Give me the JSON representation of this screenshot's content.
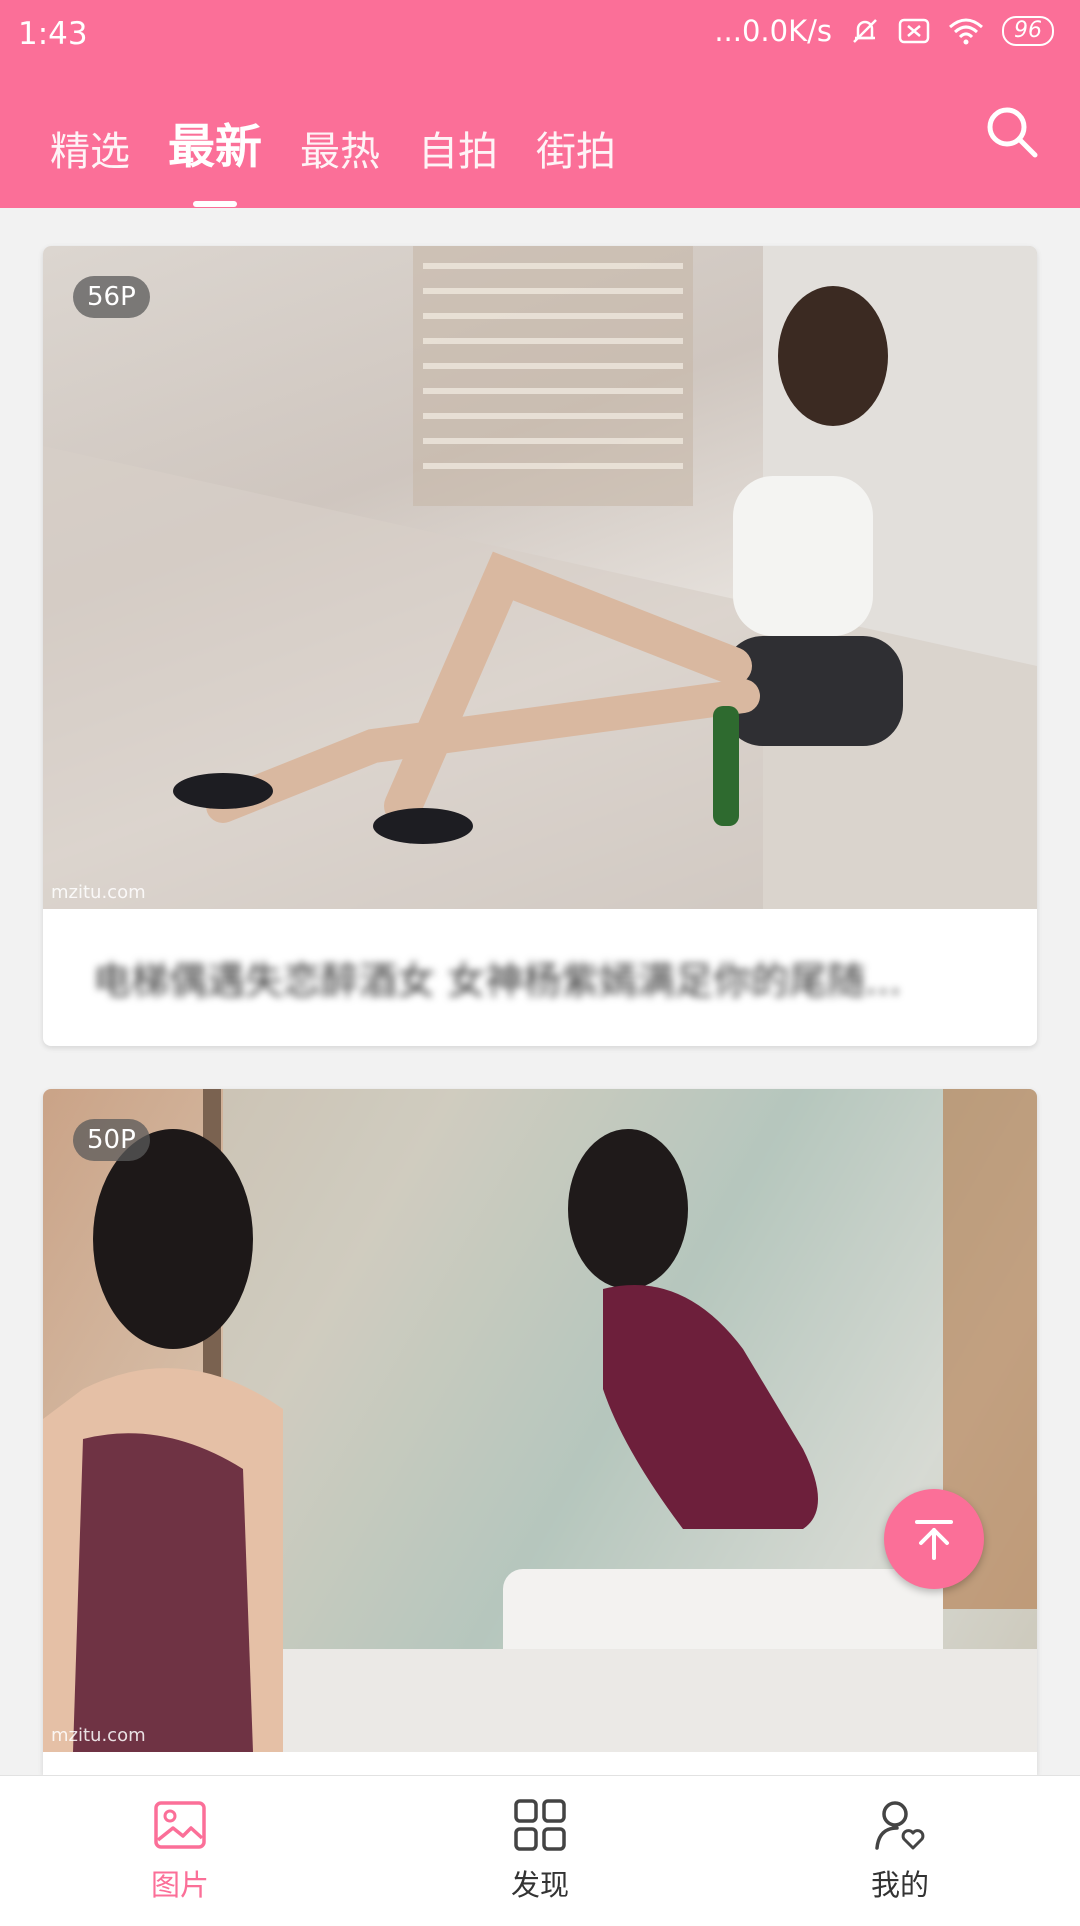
{
  "status_bar": {
    "time": "1:43",
    "network": "...0.0K/s",
    "battery": "96",
    "icons": [
      "mute-bell-icon",
      "sim-icon",
      "wifi-icon",
      "battery-icon"
    ]
  },
  "header": {
    "tabs": [
      {
        "label": "精选",
        "active": false
      },
      {
        "label": "最新",
        "active": true
      },
      {
        "label": "最热",
        "active": false
      },
      {
        "label": "自拍",
        "active": false
      },
      {
        "label": "街拍",
        "active": false
      }
    ],
    "search_icon": "search-icon"
  },
  "cards": [
    {
      "count": "56P",
      "watermark": "mzitu.com",
      "caption": "电梯偶遇失恋醉酒女 女神杨紫嫣满足你的尾随..."
    },
    {
      "count": "50P",
      "watermark": "mzitu.com",
      "caption": ""
    }
  ],
  "fab": {
    "icon": "arrow-up-to-top-icon"
  },
  "bottom_nav": [
    {
      "label": "图片",
      "icon": "image-icon",
      "active": true
    },
    {
      "label": "发现",
      "icon": "grid-icon",
      "active": false
    },
    {
      "label": "我的",
      "icon": "profile-icon",
      "active": false
    }
  ],
  "colors": {
    "accent": "#fb6f98",
    "background": "#f2f2f2"
  }
}
